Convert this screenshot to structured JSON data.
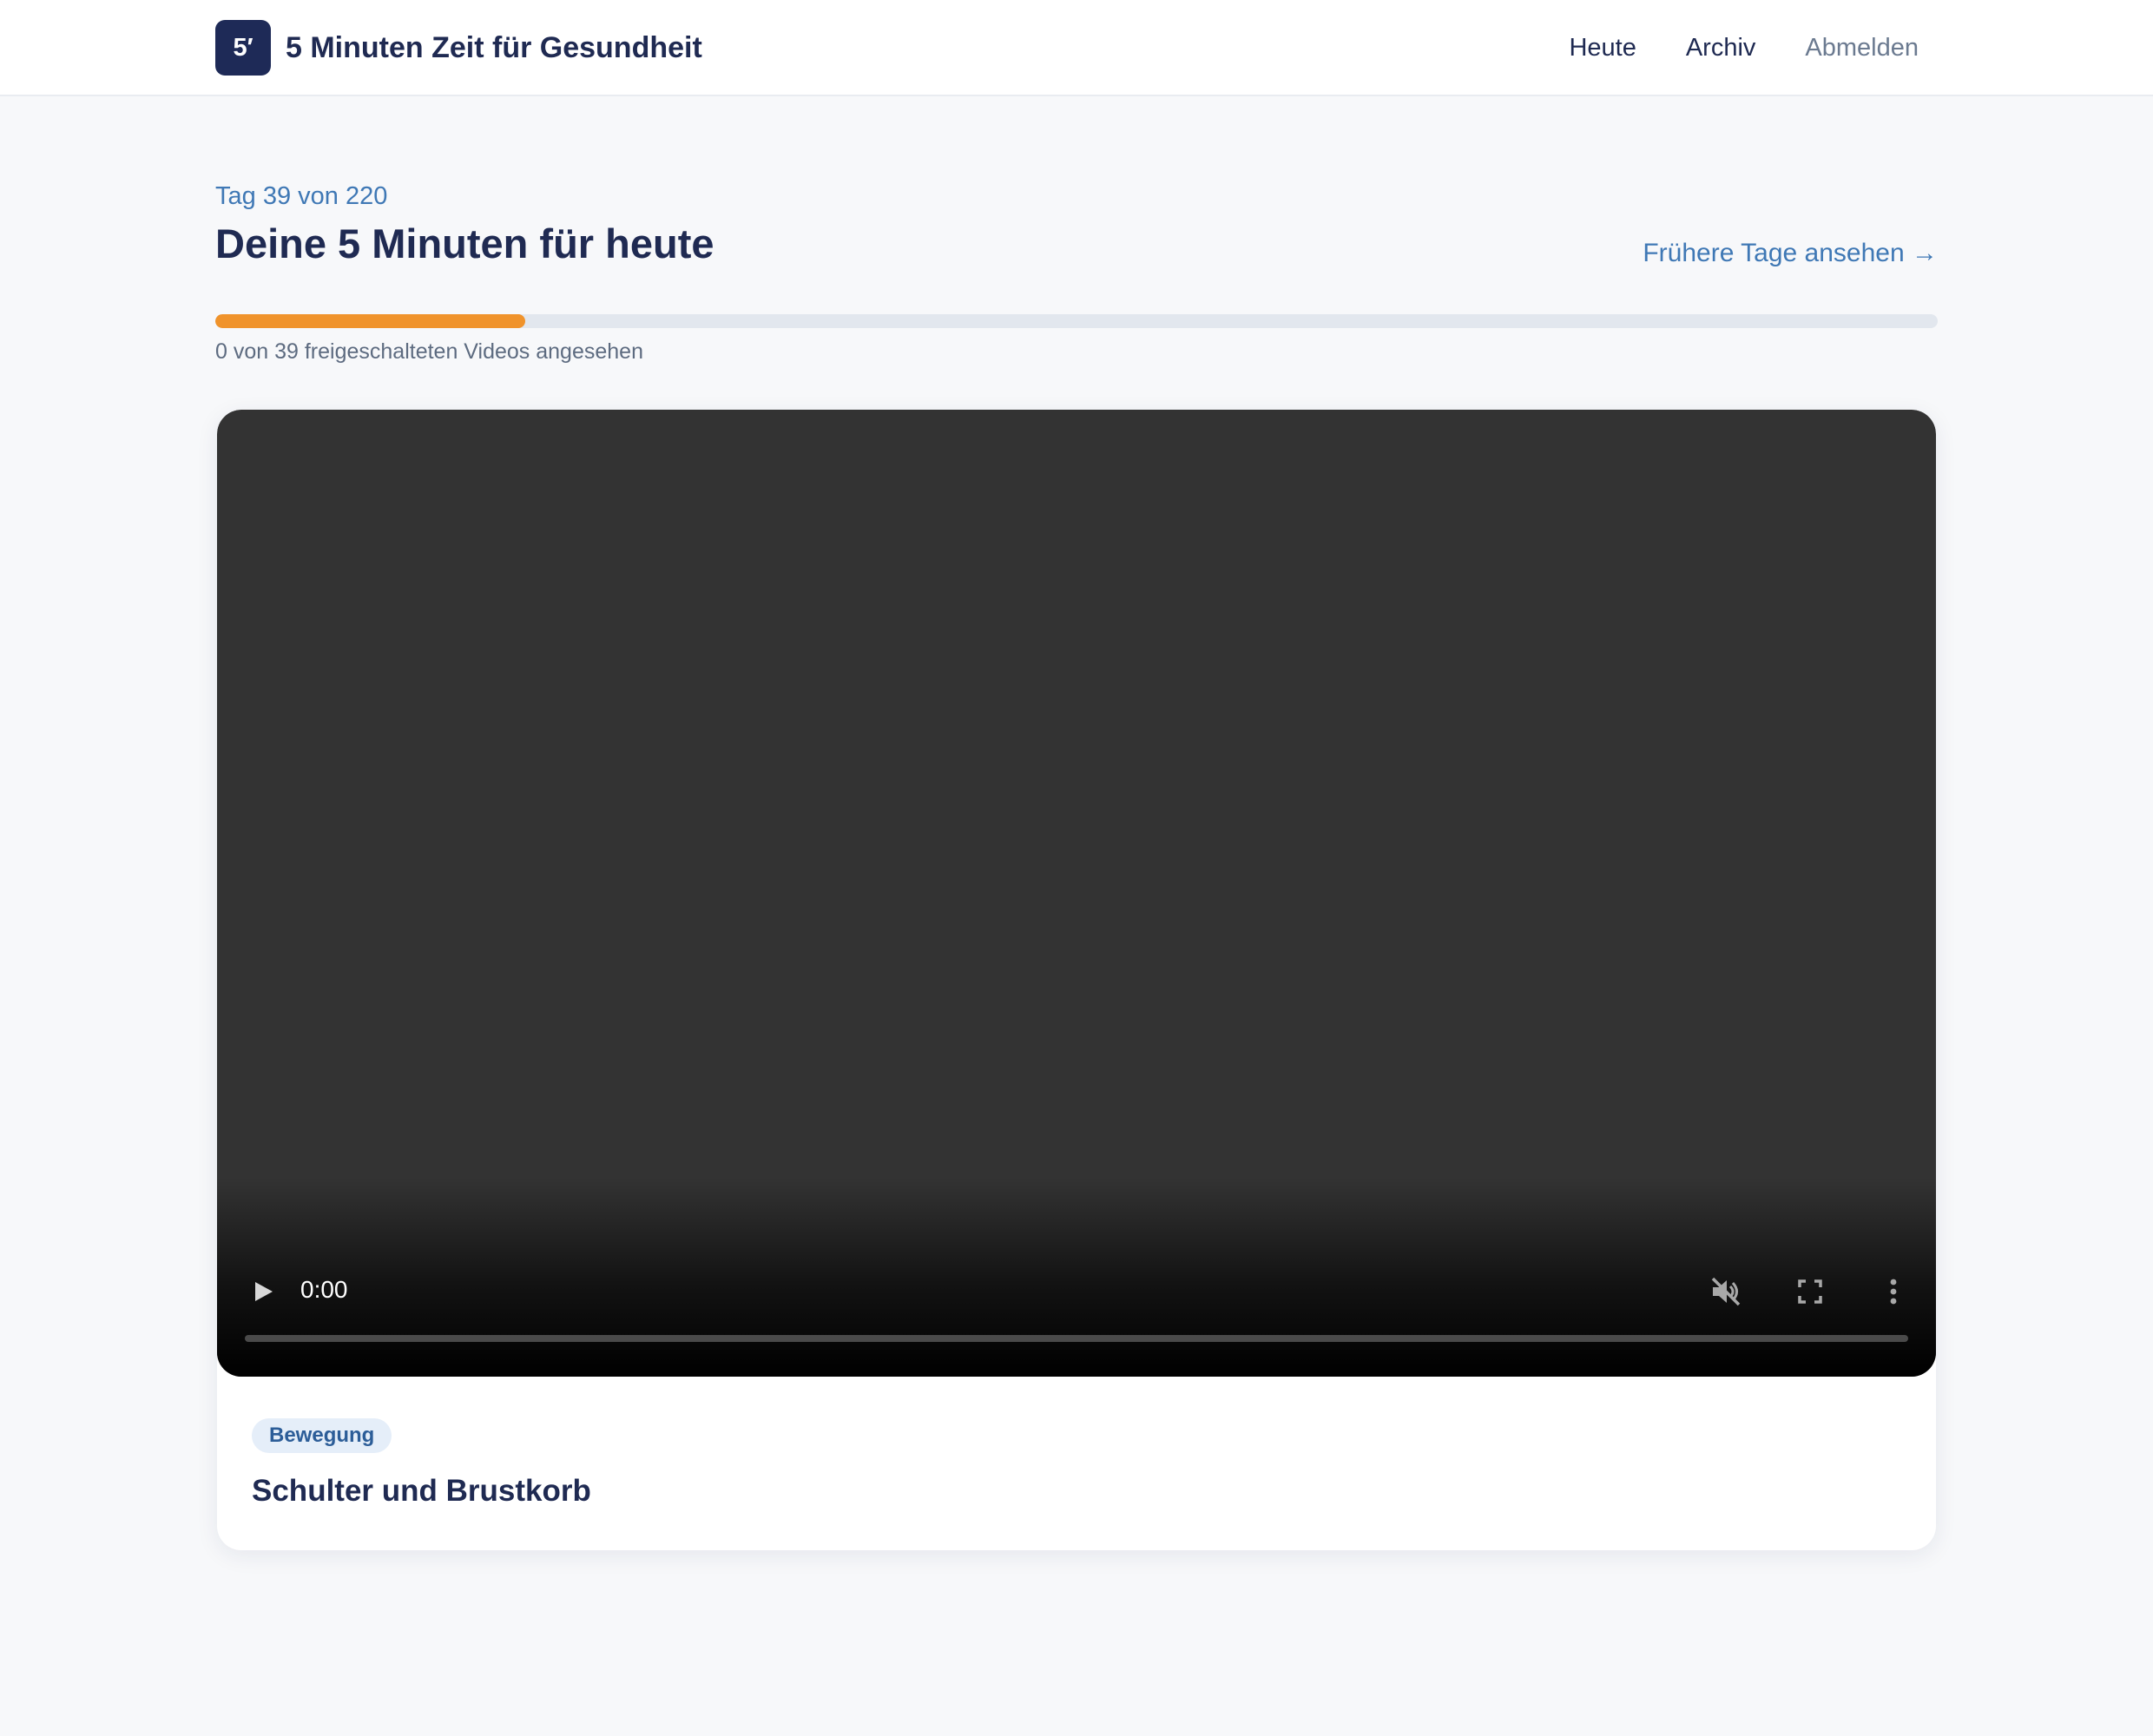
{
  "header": {
    "logo_text": "5′",
    "app_title": "5 Minuten Zeit für Gesundheit",
    "nav": {
      "today": "Heute",
      "archive": "Archiv",
      "logout": "Abmelden"
    }
  },
  "main": {
    "day_counter": "Tag 39 von 220",
    "title": "Deine 5 Minuten für heute",
    "archive_link": "Frühere Tage ansehen →",
    "progress": {
      "fraction": 0.18,
      "label": "0 von 39 freigeschalteten Videos angesehen"
    }
  },
  "video_card": {
    "player": {
      "current_time": "0:00",
      "icons": [
        "play-icon",
        "muted-volume-icon",
        "fullscreen-icon",
        "more-vertical-icon"
      ]
    },
    "category": "Bewegung",
    "title": "Schulter und Brustkorb"
  },
  "colors": {
    "brand": "#1e2a57",
    "accent_blue": "#3f78b5",
    "progress_fill": "#f0932b",
    "progress_track": "#e2e7ee",
    "page_background": "#f7f8fa",
    "tag_background": "#e5eef9"
  }
}
